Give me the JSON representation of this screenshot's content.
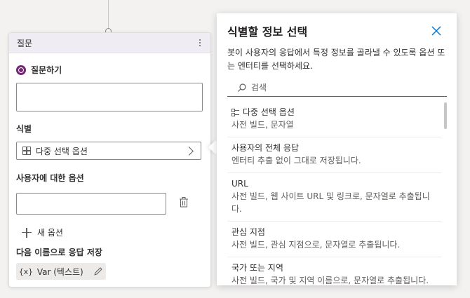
{
  "node": {
    "header_title": "질문",
    "ask_label": "질문하기",
    "identify_label": "식별",
    "identify_value": "다중 선택 옵션",
    "options_label": "사용자에 대한 옵션",
    "new_option_label": "새 옵션",
    "save_label": "다음 이름으로 응답 저장",
    "variable_icon": "{x}",
    "variable_text": "Var (텍스트)"
  },
  "panel": {
    "title": "식별할 정보 선택",
    "description": "봇이 사용자의 응답에서 특정 정보를 골라낼 수 있도록 옵션 또는 엔터티를 선택하세요.",
    "search_placeholder": "검색",
    "items": [
      {
        "title": "다중 선택 옵션",
        "desc": "사전 빌드, 문자열",
        "icon": "list-icon"
      },
      {
        "title": "사용자의 전체 응답",
        "desc": "엔터티 추출 없이 그대로 저장됩니다."
      },
      {
        "title": "URL",
        "desc": "사전 빌드, 웹 사이트 URL 및 링크로, 문자열로 추출됩니다."
      },
      {
        "title": "관심 지점",
        "desc": "사전 빌드, 관심 지점으로, 문자열로 추출됩니다."
      },
      {
        "title": "국가 또는 지역",
        "desc": "사전 빌드, 국가 및 지역 이름으로, 문자열로 추출됩니다."
      }
    ]
  },
  "colors": {
    "accent": "#742774",
    "header_bg": "#f0ecf4",
    "close_icon": "#0078d4"
  }
}
